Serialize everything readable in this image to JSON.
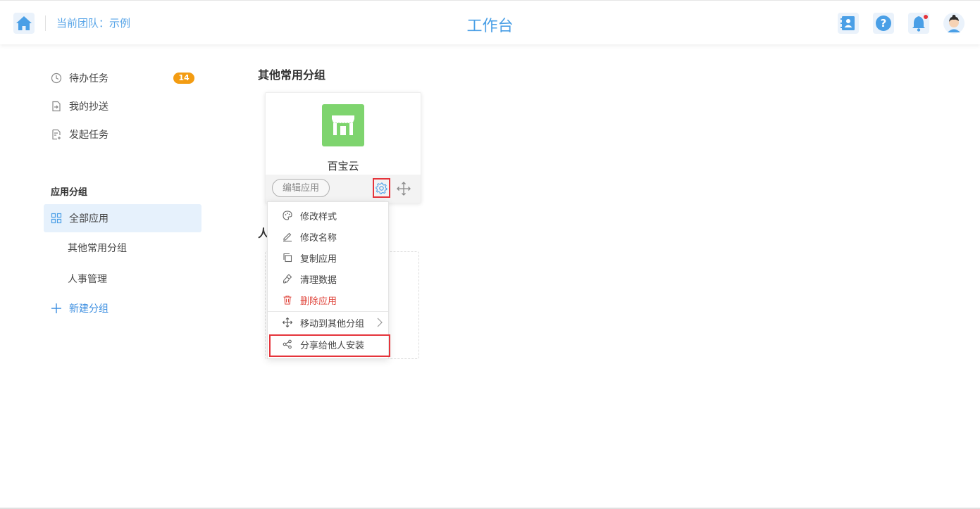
{
  "header": {
    "team_label": "当前团队：示例",
    "title": "工作台",
    "icons": [
      "home-icon",
      "contacts-icon",
      "help-icon",
      "bell-icon",
      "avatar"
    ]
  },
  "sidebar": {
    "items": [
      {
        "label": "待办任务",
        "icon": "clock-icon",
        "badge": "14"
      },
      {
        "label": "我的抄送",
        "icon": "send-doc-icon"
      },
      {
        "label": "发起任务",
        "icon": "new-doc-icon"
      }
    ],
    "section_title": "应用分组",
    "groups": [
      {
        "label": "全部应用",
        "icon": "grid-icon",
        "active": true
      },
      {
        "label": "其他常用分组"
      },
      {
        "label": "人事管理"
      }
    ],
    "new_group_label": "新建分组"
  },
  "main": {
    "group1_title": "其他常用分组",
    "group2_title_partial": "人",
    "app": {
      "name": "百宝云",
      "edit_label": "编辑应用",
      "logo_color": "#7ed46e"
    }
  },
  "menu": {
    "items": [
      {
        "label": "修改样式",
        "icon": "palette-icon"
      },
      {
        "label": "修改名称",
        "icon": "pencil-icon"
      },
      {
        "label": "复制应用",
        "icon": "copy-icon"
      },
      {
        "label": "清理数据",
        "icon": "brush-icon"
      },
      {
        "label": "删除应用",
        "icon": "trash-icon",
        "danger": true
      },
      {
        "label": "移动到其他分组",
        "icon": "move-icon",
        "submenu": true
      },
      {
        "label": "分享给他人安装",
        "icon": "share-icon",
        "highlighted": true
      }
    ]
  },
  "colors": {
    "accent": "#4a9fe6",
    "badge": "#f39c12",
    "danger": "#e0483f",
    "highlight_box": "#e5343b"
  }
}
